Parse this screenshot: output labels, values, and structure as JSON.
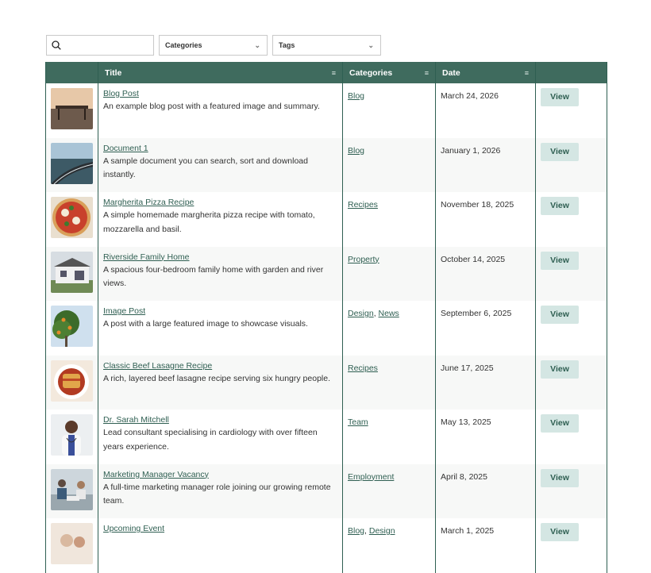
{
  "filters": {
    "search_placeholder": "",
    "categories_label": "Categories",
    "tags_label": "Tags"
  },
  "columns": {
    "title": "Title",
    "categories": "Categories",
    "date": "Date"
  },
  "button_label": "View",
  "rows": [
    {
      "title": "Blog Post",
      "desc": "An example blog post with a featured image and summary.",
      "cats": [
        "Blog"
      ],
      "date": "March 24, 2026",
      "thumb": "pier"
    },
    {
      "title": "Document 1",
      "desc": "A sample document you can search, sort and download instantly.",
      "cats": [
        "Blog"
      ],
      "date": "January 1, 2026",
      "thumb": "road"
    },
    {
      "title": "Margherita Pizza Recipe",
      "desc": "A simple homemade margherita pizza recipe with tomato, mozzarella and basil.",
      "cats": [
        "Recipes"
      ],
      "date": "November 18, 2025",
      "thumb": "pizza"
    },
    {
      "title": "Riverside Family Home",
      "desc": "A spacious four-bedroom family home with garden and river views.",
      "cats": [
        "Property"
      ],
      "date": "October 14, 2025",
      "thumb": "house"
    },
    {
      "title": "Image Post",
      "desc": "A post with a large featured image to showcase visuals.",
      "cats": [
        "Design",
        "News"
      ],
      "date": "September 6, 2025",
      "thumb": "tree"
    },
    {
      "title": "Classic Beef Lasagne Recipe",
      "desc": "A rich, layered beef lasagne recipe serving six hungry people.",
      "cats": [
        "Recipes"
      ],
      "date": "June 17, 2025",
      "thumb": "lasagne"
    },
    {
      "title": "Dr. Sarah Mitchell",
      "desc": "Lead consultant specialising in cardiology with over fifteen years experience.",
      "cats": [
        "Team"
      ],
      "date": "May 13, 2025",
      "thumb": "doctor"
    },
    {
      "title": "Marketing Manager Vacancy",
      "desc": "A full-time marketing manager role joining our growing remote team.",
      "cats": [
        "Employment"
      ],
      "date": "April 8, 2025",
      "thumb": "office"
    },
    {
      "title": "Upcoming Event",
      "desc": "",
      "cats": [
        "Blog",
        "Design"
      ],
      "date": "March 1, 2025",
      "thumb": "event"
    }
  ]
}
